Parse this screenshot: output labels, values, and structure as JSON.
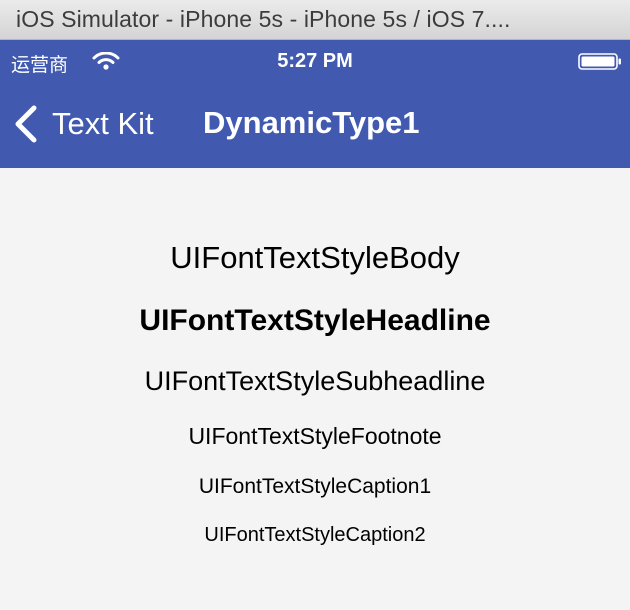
{
  "window": {
    "title": "iOS Simulator - iPhone 5s - iPhone 5s / iOS 7...."
  },
  "status_bar": {
    "carrier": "运营商",
    "time": "5:27 PM",
    "icons": [
      "wifi-icon",
      "battery-icon"
    ]
  },
  "nav_bar": {
    "back_label": "Text Kit",
    "back_icon": "chevron-left-icon",
    "title": "DynamicType1"
  },
  "content": {
    "body": "UIFontTextStyleBody",
    "headline": "UIFontTextStyleHeadline",
    "subheadline": "UIFontTextStyleSubheadline",
    "footnote": "UIFontTextStyleFootnote",
    "caption1": "UIFontTextStyleCaption1",
    "caption2": "UIFontTextStyleCaption2"
  },
  "colors": {
    "nav_background": "#415aaf",
    "content_background": "#f4f4f4",
    "text": "#000000"
  }
}
